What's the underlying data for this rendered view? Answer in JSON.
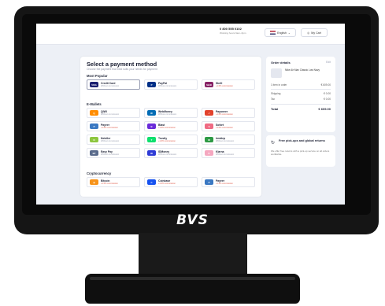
{
  "device": {
    "brand": "BVS"
  },
  "header": {
    "phone": "0 800 555 0102",
    "phone_sub": "Working hours 9am–6pm",
    "language": "English",
    "cart": "My Cart"
  },
  "payment": {
    "title": "Select a payment method",
    "subtitle": "Choose the payment that best suits your needs for payment",
    "sections": [
      {
        "label": "Most Popular",
        "options": [
          {
            "name": "Credit Card",
            "fee": "Without commission",
            "logo": "VISA",
            "color": "#1a1f71",
            "selected": true
          },
          {
            "name": "PayPal",
            "fee": "Without commission",
            "logo": "P",
            "color": "#003087"
          },
          {
            "name": "Skrill",
            "fee": "+1.6% commission",
            "logo": "Skrill",
            "color": "#862165",
            "red": true
          }
        ]
      },
      {
        "label": "E-Wallets",
        "options": [
          {
            "name": "QIWI",
            "fee": "Without commission",
            "logo": "Q",
            "color": "#ff8c00"
          },
          {
            "name": "WebMoney",
            "fee": "Without commission",
            "logo": "W",
            "color": "#036cb5"
          },
          {
            "name": "Payoneer",
            "fee": "+1.6% commission",
            "logo": "✓",
            "color": "#e2412c",
            "red": true
          },
          {
            "name": "Payeer",
            "fee": "+1.6% commission",
            "logo": "P",
            "color": "#3a78c2",
            "red": true
          },
          {
            "name": "Blast",
            "fee": "+1.6% commission",
            "logo": "B",
            "color": "#6a2bd9",
            "red": true
          },
          {
            "name": "Sofort",
            "fee": "+1.6% commission",
            "logo": "S",
            "color": "#ef6a83",
            "red": true
          },
          {
            "name": "Neteller",
            "fee": "Without commission",
            "logo": "N",
            "color": "#8dc63f"
          },
          {
            "name": "Trustly",
            "fee": "+1.6% commission",
            "logo": "T",
            "color": "#0ee06e",
            "red": true
          },
          {
            "name": "Instdep",
            "fee": "Without commission",
            "logo": "ID",
            "color": "#2d9a45"
          },
          {
            "name": "Easy Pay",
            "fee": "Without commission",
            "logo": "EP",
            "color": "#5a6b8c"
          },
          {
            "name": "IDMoney",
            "fee": "Without commission",
            "logo": "ID",
            "color": "#2e3bd6"
          },
          {
            "name": "Klarna",
            "fee": "Without commission",
            "logo": "K",
            "color": "#f5a7c0"
          }
        ]
      },
      {
        "label": "Cryptocurrency",
        "options": [
          {
            "name": "Bitcoin",
            "fee": "+1.5% commission",
            "logo": "₿",
            "color": "#f7931a",
            "red": true
          },
          {
            "name": "Coinbase",
            "fee": "+1.2% commission",
            "logo": "C",
            "color": "#1652f0",
            "red": true
          },
          {
            "name": "Payeer",
            "fee": "+1.2% commission",
            "logo": "P",
            "color": "#3a78c2",
            "red": true
          }
        ]
      }
    ]
  },
  "order": {
    "title": "Order details",
    "edit": "Edit",
    "item": "Nike Air Max Classic Low Navy",
    "qty_label": "1 item in order",
    "qty_value": "€ 609.00",
    "shipping_label": "Shipping",
    "shipping_value": "€ 0.00",
    "tax_label": "Tax",
    "tax_value": "€ 0.00",
    "total_label": "Total",
    "total_value": "€ 609.00"
  },
  "promo": {
    "icon": "↻",
    "title": "Free pick-ups and global returns",
    "text": "We offer free returns with a pick-up service on all orders worldwide."
  }
}
